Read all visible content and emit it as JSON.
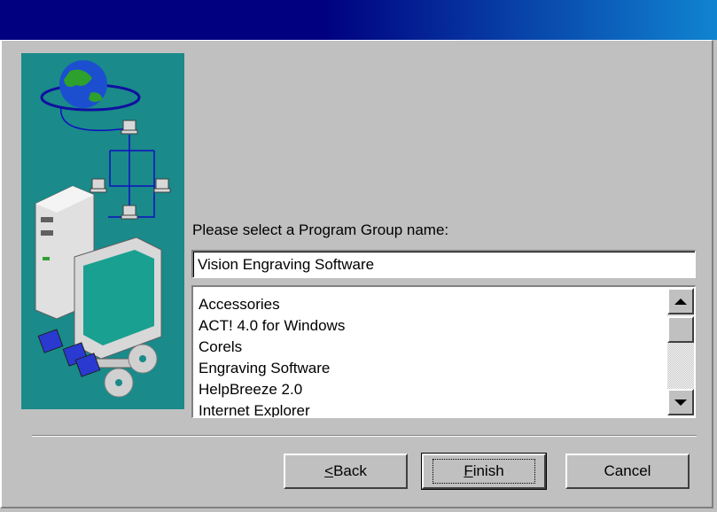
{
  "dialog": {
    "prompt_label": "Please select a Program Group name:",
    "group_name_value": "Vision Engraving Software"
  },
  "program_groups": [
    "Accessories",
    "ACT! 4.0 for Windows",
    "Corels",
    "Engraving Software",
    "HelpBreeze 2.0",
    "Internet Explorer"
  ],
  "buttons": {
    "back": {
      "mnemonic": "<",
      "rest": "Back"
    },
    "finish": {
      "mnemonic": "F",
      "rest": "inish"
    },
    "cancel": "Cancel"
  },
  "colors": {
    "title_start": "#000080",
    "title_end": "#1084d0",
    "face": "#c0c0c0",
    "art_bg": "#1a8a8a"
  },
  "icons": {
    "art": "setup-computer-network-illustration",
    "scroll_up": "arrow-up-icon",
    "scroll_down": "arrow-down-icon"
  }
}
